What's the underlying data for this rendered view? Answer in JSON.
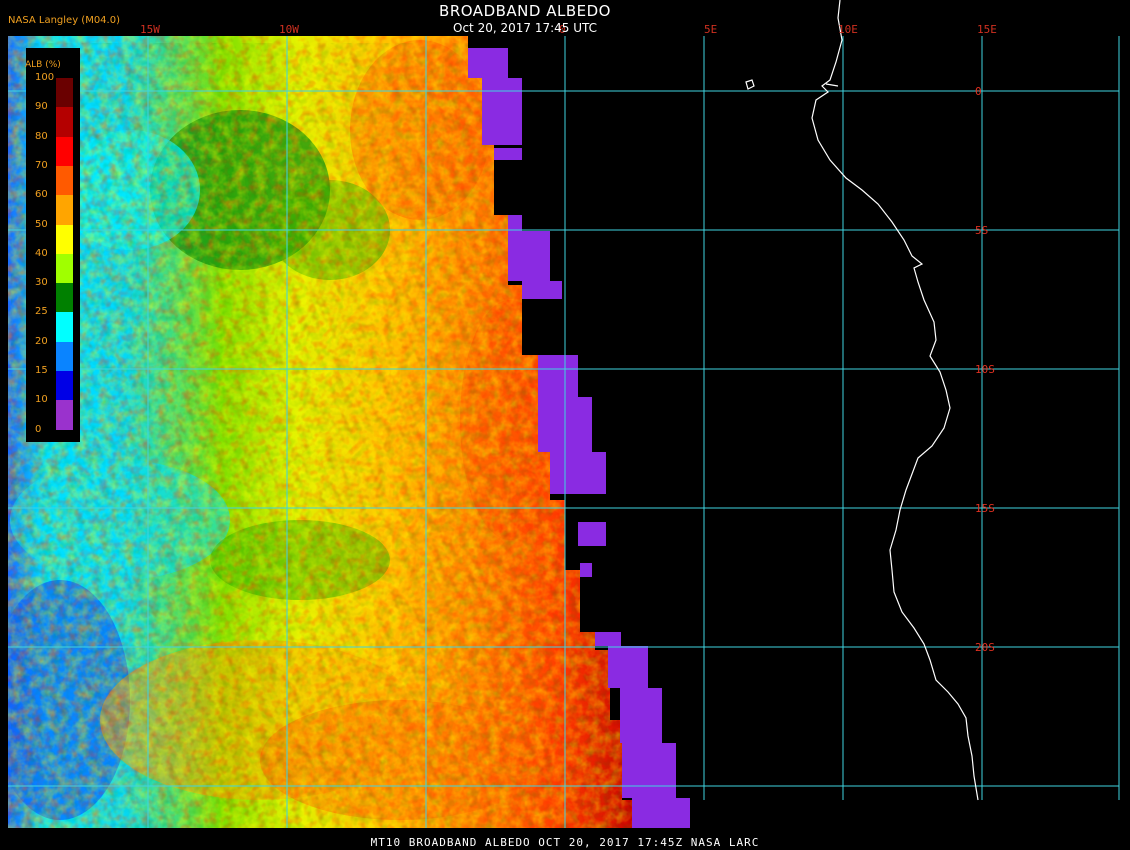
{
  "header": {
    "title": "BROADBAND ALBEDO",
    "subtitle": "Oct 20, 2017 17:45 UTC",
    "source": "NASA Langley (M04.0)"
  },
  "footer": {
    "text": "MT10  BROADBAND ALBEDO  OCT 20, 2017 17:45Z  NASA LARC"
  },
  "longitude_labels": [
    "15W",
    "10W",
    "0",
    "5E",
    "10E",
    "15E"
  ],
  "latitude_labels": [
    "0",
    "5S",
    "10S",
    "15S",
    "20S"
  ],
  "legend": {
    "title": "ALB (%)",
    "ticks": [
      "100",
      "90",
      "80",
      "70",
      "60",
      "50",
      "40",
      "30",
      "25",
      "20",
      "15",
      "10",
      "0"
    ],
    "colors": [
      "#6a0000",
      "#b40000",
      "#ff0000",
      "#ff5a00",
      "#ffa500",
      "#ffff00",
      "#a0ff00",
      "#008000",
      "#00ffff",
      "#0a84ff",
      "#0000e6",
      "#9a32cd"
    ]
  },
  "colors": {
    "grid": "#3fd4e0",
    "lat_label": "#e03020",
    "lon_label": "#d03020",
    "coast": "#ffffff",
    "no_data": "#8a2be2"
  }
}
